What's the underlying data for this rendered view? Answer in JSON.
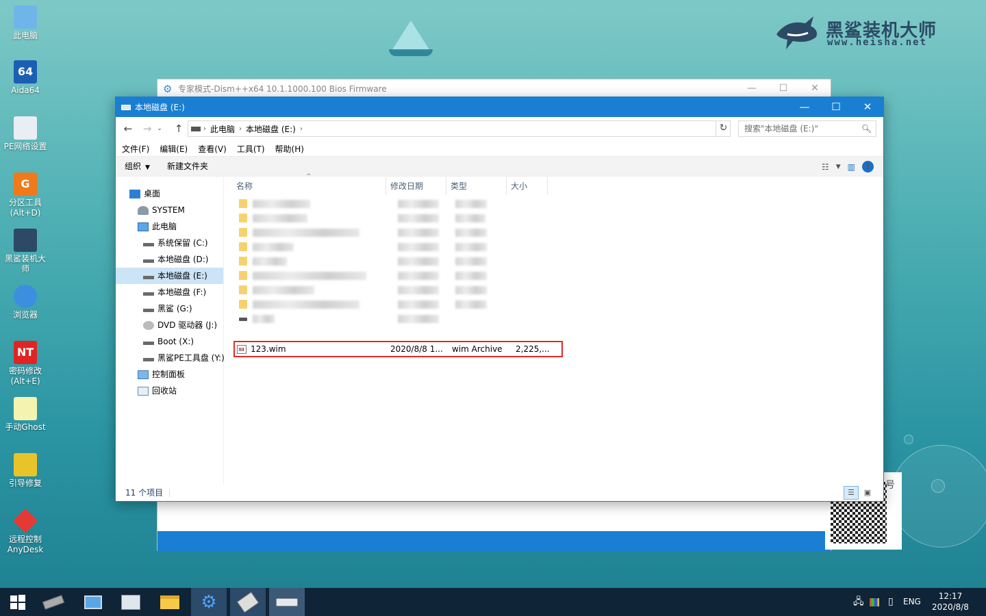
{
  "brand": {
    "title": "黑鲨装机大师",
    "url": "www.heisha.net"
  },
  "desktop_icons": [
    {
      "label": "此电脑",
      "icon": "computer-icon"
    },
    {
      "label": "Aida64",
      "icon": "aida64-icon",
      "badge": "64"
    },
    {
      "label": "PE网络设置",
      "icon": "network-icon"
    },
    {
      "label": "分区工具\n(Alt+D)",
      "icon": "partition-tool-icon",
      "badge": "G"
    },
    {
      "label": "黑鲨装机大师",
      "icon": "heisha-shark-icon"
    },
    {
      "label": "浏览器",
      "icon": "browser-icon"
    },
    {
      "label": "密码修改\n(Alt+E)",
      "icon": "password-key-icon",
      "badge": "NT"
    },
    {
      "label": "手动Ghost",
      "icon": "ghost-icon"
    },
    {
      "label": "引导修复",
      "icon": "boot-repair-icon"
    },
    {
      "label": "远程控制\nAnyDesk",
      "icon": "anydesk-icon"
    }
  ],
  "dism_window": {
    "title": "专家模式-Dism++x64 10.1.1000.100 Bios Firmware",
    "side_char": "号"
  },
  "explorer": {
    "title": "本地磁盘 (E:)",
    "address": {
      "crumbs": [
        "此电脑",
        "本地磁盘 (E:)"
      ]
    },
    "search_placeholder": "搜索\"本地磁盘 (E:)\"",
    "menu": [
      "文件(F)",
      "编辑(E)",
      "查看(V)",
      "工具(T)",
      "帮助(H)"
    ],
    "toolbar": {
      "organize": "组织",
      "new_folder": "新建文件夹"
    },
    "nav": [
      {
        "label": "桌面",
        "icon": "desktop-icon"
      },
      {
        "label": "SYSTEM",
        "icon": "user-icon"
      },
      {
        "label": "此电脑",
        "icon": "computer-icon"
      },
      {
        "label": "系统保留 (C:)",
        "icon": "drive-icon"
      },
      {
        "label": "本地磁盘 (D:)",
        "icon": "drive-icon"
      },
      {
        "label": "本地磁盘 (E:)",
        "icon": "drive-icon",
        "selected": true
      },
      {
        "label": "本地磁盘 (F:)",
        "icon": "drive-icon"
      },
      {
        "label": "黑鲨 (G:)",
        "icon": "drive-icon"
      },
      {
        "label": "DVD 驱动器 (J:)",
        "icon": "dvd-icon"
      },
      {
        "label": "Boot (X:)",
        "icon": "drive-icon"
      },
      {
        "label": "黑鲨PE工具盘 (Y:)",
        "icon": "drive-icon"
      },
      {
        "label": "控制面板",
        "icon": "control-panel-icon"
      },
      {
        "label": "回收站",
        "icon": "recycle-bin-icon"
      }
    ],
    "columns": [
      "名称",
      "修改日期",
      "类型",
      "大小"
    ],
    "file": {
      "name": "123.wim",
      "date": "2020/8/8 1...",
      "type": "wim Archive",
      "size": "2,225,..."
    },
    "status": "11 个项目"
  },
  "taskbar": {
    "tray_lang": "ENG",
    "time": "12:17",
    "date": "2020/8/8"
  },
  "colors": {
    "accent": "#1a7fd2",
    "highlight": "#e02a2a",
    "selected": "#cce4f7"
  }
}
